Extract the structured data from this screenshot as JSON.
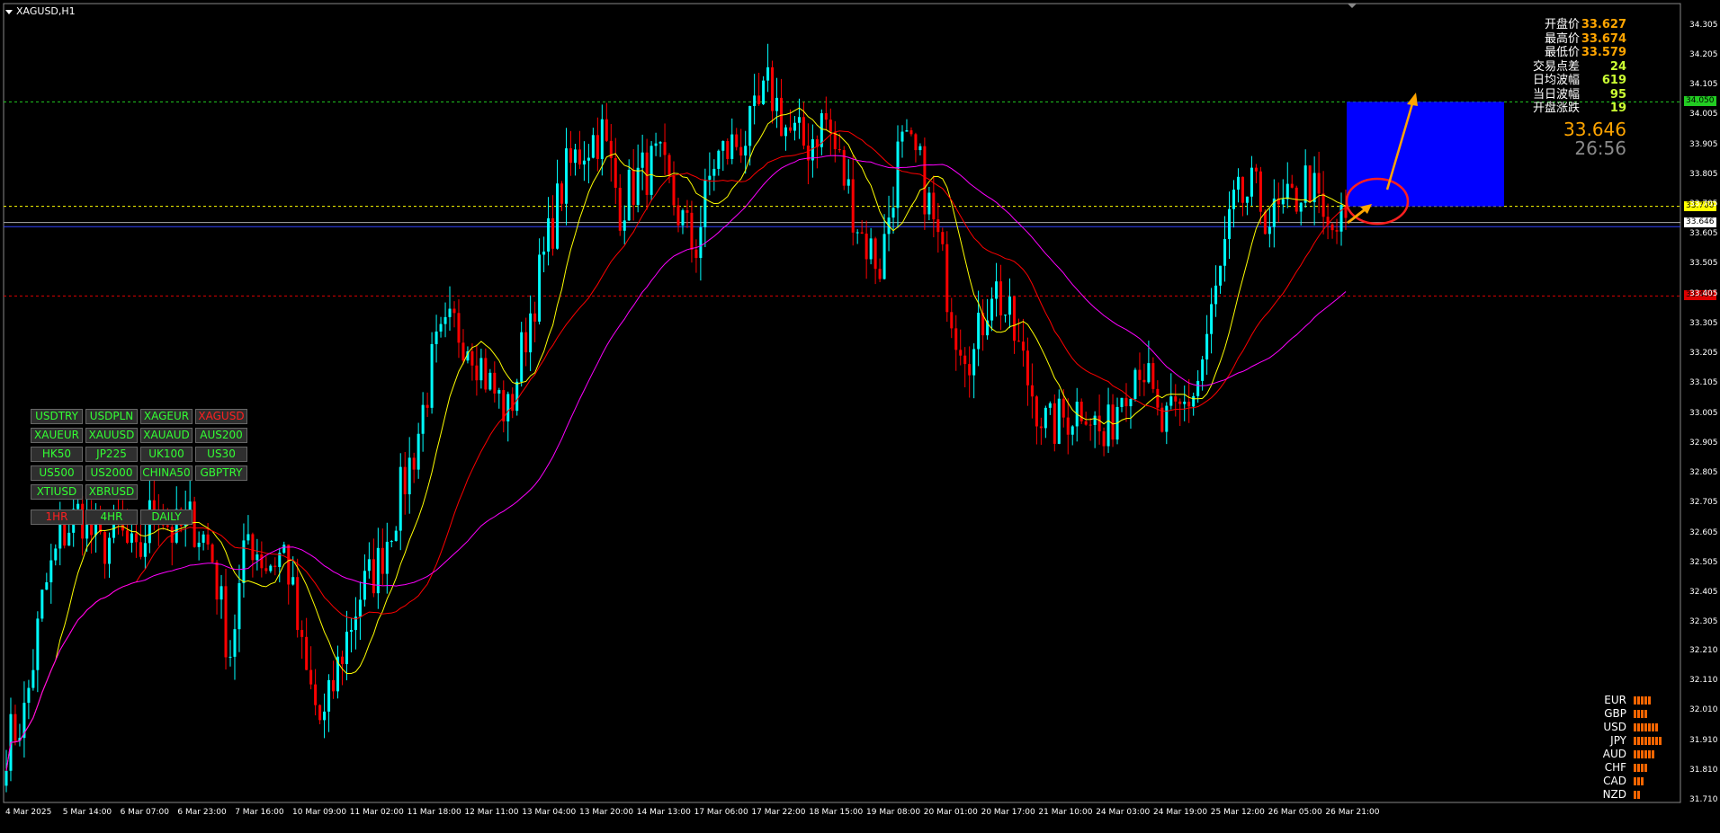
{
  "chart": {
    "title": "XAGUSD,H1"
  },
  "info_panel": [
    {
      "label": "开盘价",
      "value": "33.627",
      "color": "#ffa500"
    },
    {
      "label": "最高价",
      "value": "33.674",
      "color": "#ffa500"
    },
    {
      "label": "最低价",
      "value": "33.579",
      "color": "#ffa500"
    },
    {
      "label": "交易点差",
      "value": "24",
      "color": "#ccff33"
    },
    {
      "label": "日均波幅",
      "value": "619",
      "color": "#ccff33"
    },
    {
      "label": "当日波幅",
      "value": "95",
      "color": "#ccff33"
    },
    {
      "label": "开盘涨跌",
      "value": "19",
      "color": "#ccff33"
    }
  ],
  "current_price": "33.646",
  "countdown": "26:56",
  "symbols": [
    {
      "label": "USDTRY",
      "active": false
    },
    {
      "label": "USDPLN",
      "active": false
    },
    {
      "label": "XAGEUR",
      "active": false
    },
    {
      "label": "XAGUSD",
      "active": true
    },
    {
      "label": "XAUEUR",
      "active": false
    },
    {
      "label": "XAUUSD",
      "active": false
    },
    {
      "label": "XAUAUD",
      "active": false
    },
    {
      "label": "AUS200",
      "active": false
    },
    {
      "label": "HK50",
      "active": false
    },
    {
      "label": "JP225",
      "active": false
    },
    {
      "label": "UK100",
      "active": false
    },
    {
      "label": "US30",
      "active": false
    },
    {
      "label": "US500",
      "active": false
    },
    {
      "label": "US2000",
      "active": false
    },
    {
      "label": "CHINA50",
      "active": false
    },
    {
      "label": "GBPTRY",
      "active": false
    },
    {
      "label": "XTIUSD",
      "active": false
    },
    {
      "label": "XBRUSD",
      "active": false
    }
  ],
  "timeframes": [
    {
      "label": "1HR",
      "active": true
    },
    {
      "label": "4HR",
      "active": false
    },
    {
      "label": "DAILY",
      "active": false
    }
  ],
  "currency_strength": [
    {
      "name": "EUR",
      "level": 5
    },
    {
      "name": "GBP",
      "level": 4
    },
    {
      "name": "USD",
      "level": 7
    },
    {
      "name": "JPY",
      "level": 8
    },
    {
      "name": "AUD",
      "level": 6
    },
    {
      "name": "CHF",
      "level": 4
    },
    {
      "name": "CAD",
      "level": 3
    },
    {
      "name": "NZD",
      "level": 2
    }
  ],
  "price_tags": [
    {
      "value": "34.050",
      "bg": "#22cc22"
    },
    {
      "value": "33.700",
      "bg": "#ffff00"
    },
    {
      "value": "33.646",
      "bg": "#ffffff"
    },
    {
      "value": "33.400",
      "bg": "#dd0000"
    }
  ],
  "colors": {
    "bull": "#00ffff",
    "bear": "#ff0000",
    "ma_fast": "#ffff00",
    "ma_mid": "#ff0000",
    "ma_slow": "#ff00ff",
    "target_box": "#0000ff",
    "arrow": "#ffa500"
  },
  "chart_data": {
    "type": "candlestick",
    "symbol": "XAGUSD",
    "timeframe": "H1",
    "ylim": [
      31.71,
      34.355
    ],
    "y_ticks": [
      "34.305",
      "34.205",
      "34.105",
      "34.005",
      "33.905",
      "33.805",
      "33.705",
      "33.605",
      "33.505",
      "33.405",
      "33.305",
      "33.205",
      "33.105",
      "33.005",
      "32.905",
      "32.805",
      "32.705",
      "32.605",
      "32.505",
      "32.405",
      "32.305",
      "32.210",
      "32.110",
      "32.010",
      "31.910",
      "31.810",
      "31.710"
    ],
    "x_ticks": [
      "4 Mar 2025",
      "5 Mar 14:00",
      "6 Mar 07:00",
      "6 Mar 23:00",
      "7 Mar 16:00",
      "10 Mar 09:00",
      "11 Mar 02:00",
      "11 Mar 18:00",
      "12 Mar 11:00",
      "13 Mar 04:00",
      "13 Mar 20:00",
      "14 Mar 13:00",
      "17 Mar 06:00",
      "17 Mar 22:00",
      "18 Mar 15:00",
      "19 Mar 08:00",
      "20 Mar 01:00",
      "20 Mar 17:00",
      "21 Mar 10:00",
      "24 Mar 03:00",
      "24 Mar 19:00",
      "25 Mar 12:00",
      "26 Mar 05:00",
      "26 Mar 21:00"
    ],
    "close_path": [
      31.9,
      32.0,
      32.4,
      32.6,
      32.68,
      32.55,
      32.62,
      32.5,
      32.72,
      32.6,
      32.65,
      32.55,
      32.2,
      32.6,
      32.5,
      32.55,
      32.15,
      31.95,
      32.2,
      32.4,
      32.5,
      32.7,
      32.9,
      33.2,
      33.3,
      33.25,
      33.1,
      33.0,
      33.3,
      33.55,
      33.8,
      33.9,
      33.95,
      33.7,
      33.8,
      33.85,
      33.7,
      33.55,
      33.85,
      33.9,
      33.95,
      34.1,
      33.95,
      33.9,
      34.0,
      33.8,
      33.6,
      33.5,
      33.9,
      33.85,
      33.6,
      33.3,
      33.2,
      33.45,
      33.3,
      33.1,
      32.95,
      33.0,
      33.05,
      32.9,
      33.1,
      33.2,
      32.95,
      33.0,
      33.1,
      33.4,
      33.7,
      33.75,
      33.65,
      33.7,
      33.8,
      33.6,
      33.65
    ],
    "horizontal_lines": [
      34.05,
      33.7,
      33.646,
      33.632,
      33.4
    ],
    "target_zone": {
      "price_from": 33.7,
      "price_to": 34.05
    }
  }
}
